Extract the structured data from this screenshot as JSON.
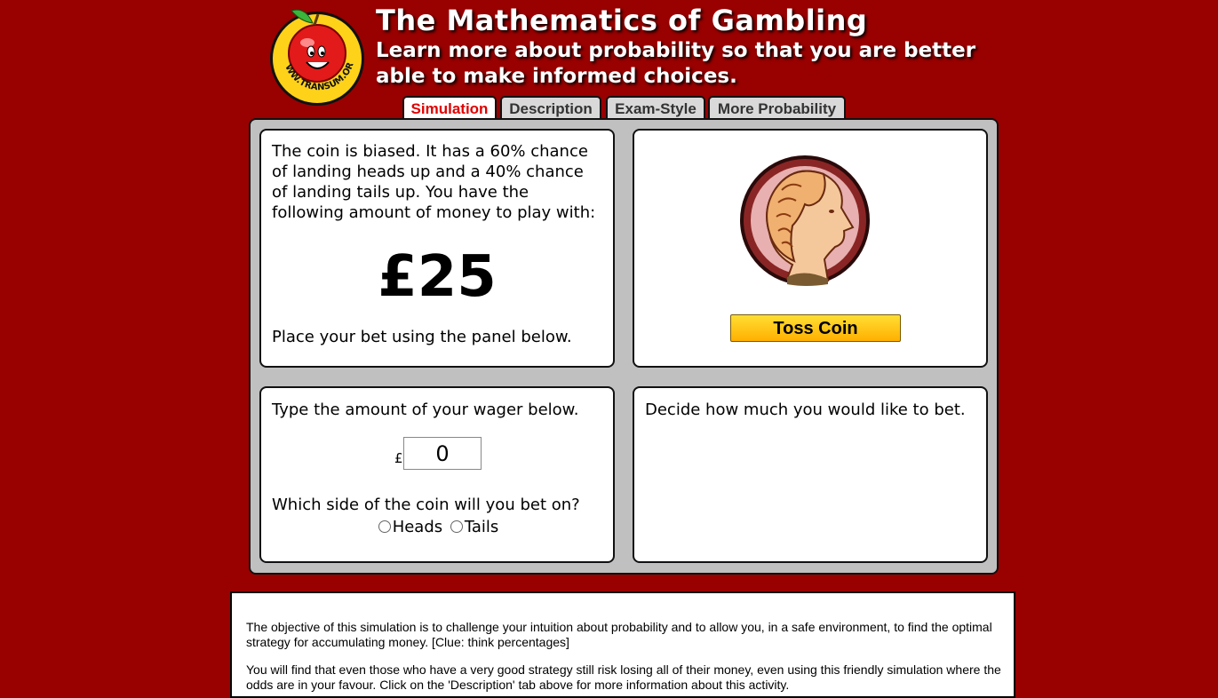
{
  "header": {
    "title": "The Mathematics of Gambling",
    "subtitle": "Learn more about probability so that you are better able to make informed choices.",
    "logo_text": "WWW.TRANSUM.ORG"
  },
  "tabs": [
    {
      "label": "Simulation",
      "active": true
    },
    {
      "label": "Description",
      "active": false
    },
    {
      "label": "Exam-Style",
      "active": false
    },
    {
      "label": "More Probability",
      "active": false
    }
  ],
  "intro_panel": {
    "text": "The coin is biased. It has a 60% chance of landing heads up and a 40% chance of landing tails up. You have the following amount of money to play with:",
    "money": "£25",
    "instruction": "Place your bet using the panel below."
  },
  "coin_panel": {
    "toss_label": "Toss Coin"
  },
  "wager_panel": {
    "label": "Type the amount of your wager below.",
    "currency_symbol": "£",
    "value": "0",
    "side_question": "Which side of the coin will you bet on?",
    "options": [
      "Heads",
      "Tails"
    ]
  },
  "status_panel": {
    "message": "Decide how much you would like to bet."
  },
  "info": {
    "paragraph1": "The objective of this simulation is to challenge your intuition about probability and to allow you, in a safe environment, to find the optimal strategy for accumulating money. [Clue: think percentages]",
    "paragraph2": "You will find that even those who have a very good strategy still risk losing all of their money, even using this friendly simulation where the odds are in your favour. Click on the 'Description' tab above for more information about this activity."
  },
  "colors": {
    "background": "#990000",
    "panel": "#c0c0c0",
    "active_tab_text": "#e00000",
    "button": "#ffc400"
  }
}
